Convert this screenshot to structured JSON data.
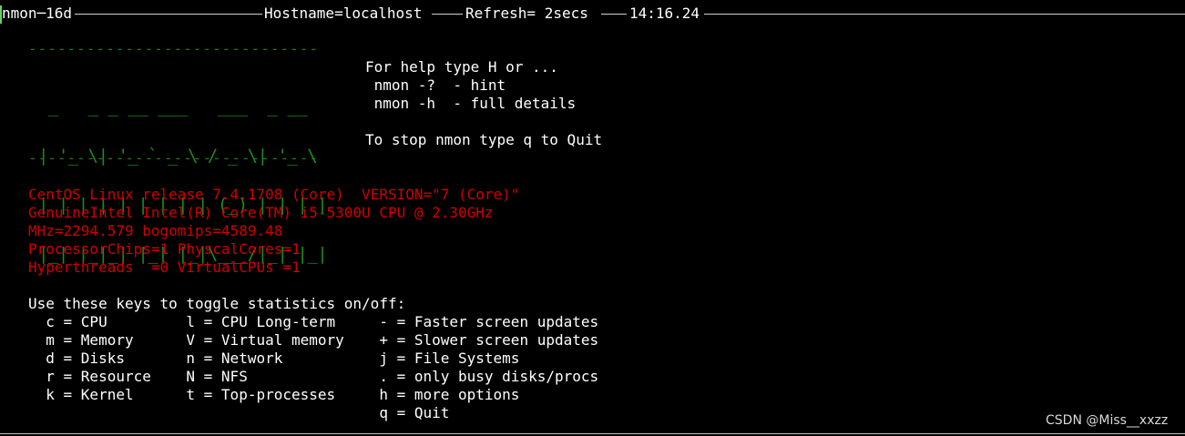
{
  "header": {
    "program": "nmon─16d",
    "hostname": "Hostname=localhost",
    "refresh": "Refresh= 2secs",
    "time": "14:16.24"
  },
  "banner": {
    "dash_line": "------------------------------",
    "logo_text": "nmon",
    "logo_art": [
      "  _   _ _ __ ___   ___  _ __  ",
      " | '_ \\| '_ ` _ \\ / _ \\| '_ \\ ",
      " | | | | | | | | | (_) | | | |",
      " |_| |_|_| |_| |_|\\___/|_| |_|"
    ]
  },
  "help": {
    "line1": "For help type H or ...",
    "line2": " nmon -?  - hint",
    "line3": " nmon -h  - full details",
    "line4": "To stop nmon type q to Quit"
  },
  "system_info": [
    "CentOS Linux release 7.4.1708 (Core)  VERSION=\"7 (Core)\"",
    "GenuineIntel Intel(R) Core(TM) i5-5300U CPU @ 2.30GHz",
    "MHz=2294.579 bogomips=4589.48",
    "ProcessorChips=1 PhyscalCores=1",
    "Hyperthreads  =0 VirtualCPUs =1"
  ],
  "keys": {
    "heading": "Use these keys to toggle statistics on/off:",
    "rows": [
      "  c = CPU         l = CPU Long-term     - = Faster screen updates",
      "  m = Memory      V = Virtual memory    + = Slower screen updates",
      "  d = Disks       n = Network           j = File Systems",
      "  r = Resource    N = NFS               . = only busy disks/procs",
      "  k = Kernel      t = Top-processes     h = more options",
      "                                        q = Quit"
    ]
  },
  "watermark": "CSDN @Miss__xxzz",
  "colors": {
    "background": "#000000",
    "text": "#ffffff",
    "info_red": "#d10000",
    "logo_green": "#1d8a1d"
  }
}
